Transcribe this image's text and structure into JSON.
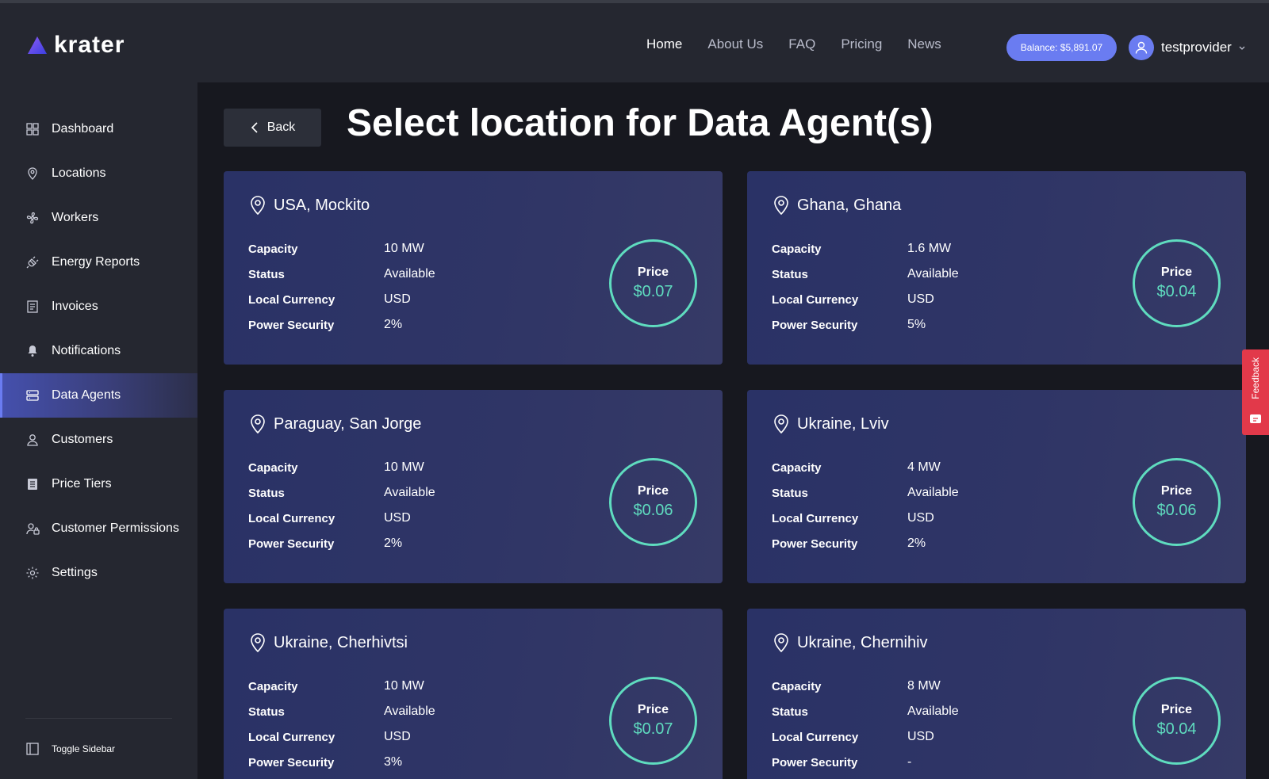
{
  "header": {
    "logo_text": "krater",
    "nav": [
      {
        "label": "Home",
        "active": true
      },
      {
        "label": "About Us",
        "active": false
      },
      {
        "label": "FAQ",
        "active": false
      },
      {
        "label": "Pricing",
        "active": false
      },
      {
        "label": "News",
        "active": false
      }
    ],
    "balance": "Balance: $5,891.07",
    "username": "testprovider"
  },
  "sidebar": {
    "items": [
      {
        "label": "Dashboard",
        "icon": "dashboard-icon"
      },
      {
        "label": "Locations",
        "icon": "location-pin-icon"
      },
      {
        "label": "Workers",
        "icon": "fan-icon"
      },
      {
        "label": "Energy Reports",
        "icon": "plug-icon"
      },
      {
        "label": "Invoices",
        "icon": "invoice-icon"
      },
      {
        "label": "Notifications",
        "icon": "bell-icon"
      },
      {
        "label": "Data Agents",
        "icon": "server-icon",
        "active": true
      },
      {
        "label": "Customers",
        "icon": "user-icon"
      },
      {
        "label": "Price Tiers",
        "icon": "list-icon"
      },
      {
        "label": "Customer Permissions",
        "icon": "user-lock-icon"
      },
      {
        "label": "Settings",
        "icon": "gear-icon"
      }
    ],
    "toggle_label": "Toggle Sidebar"
  },
  "page": {
    "back_label": "Back",
    "title": "Select location for Data Agent(s)"
  },
  "field_labels": {
    "capacity": "Capacity",
    "status": "Status",
    "currency": "Local Currency",
    "security": "Power Security",
    "price": "Price"
  },
  "locations": [
    {
      "name": "USA, Mockito",
      "capacity": "10 MW",
      "status": "Available",
      "currency": "USD",
      "security": "2%",
      "price": "$0.07"
    },
    {
      "name": "Ghana, Ghana",
      "capacity": "1.6 MW",
      "status": "Available",
      "currency": "USD",
      "security": "5%",
      "price": "$0.04"
    },
    {
      "name": "Paraguay, San Jorge",
      "capacity": "10 MW",
      "status": "Available",
      "currency": "USD",
      "security": "2%",
      "price": "$0.06"
    },
    {
      "name": "Ukraine, Lviv",
      "capacity": "4 MW",
      "status": "Available",
      "currency": "USD",
      "security": "2%",
      "price": "$0.06"
    },
    {
      "name": "Ukraine, Cherhivtsi",
      "capacity": "10 MW",
      "status": "Available",
      "currency": "USD",
      "security": "3%",
      "price": "$0.07"
    },
    {
      "name": "Ukraine, Chernihiv",
      "capacity": "8 MW",
      "status": "Available",
      "currency": "USD",
      "security": "-",
      "price": "$0.04"
    }
  ],
  "feedback_label": "Feedback",
  "colors": {
    "accent": "#6a7cf1",
    "price_ring": "#5fdcbf",
    "feedback": "#e2394a"
  }
}
